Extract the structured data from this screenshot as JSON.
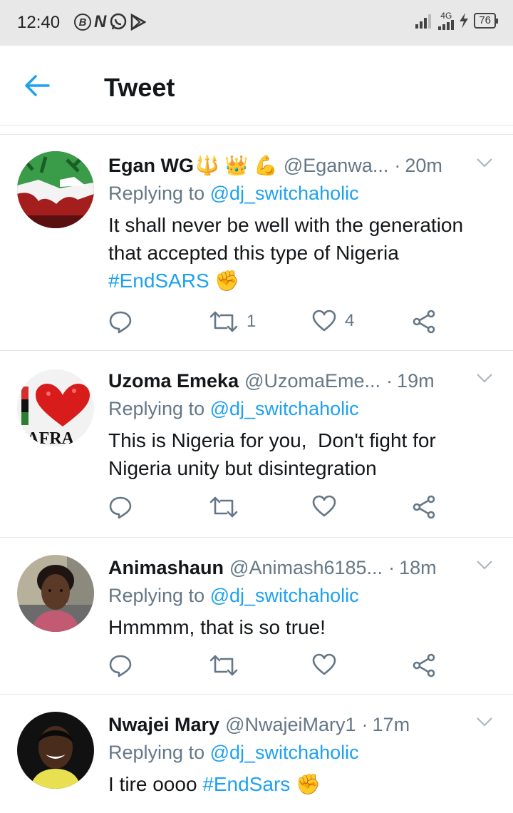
{
  "status_bar": {
    "time": "12:40",
    "left_icon_labels": [
      "B",
      "N"
    ],
    "network": "4G",
    "battery": "76"
  },
  "header": {
    "title": "Tweet"
  },
  "tweets": [
    {
      "name": "Egan WG",
      "name_emojis": "🔱 👑 💪",
      "handle": "@Eganwa...",
      "time": "20m",
      "reply_prefix": "Replying to",
      "reply_to": "@dj_switchaholic",
      "text": "It shall never be well with the generation that accepted this type of Nigeria",
      "hashtag": "#EndSARS",
      "hashtag_emoji": "✊",
      "retweets": "1",
      "likes": "4"
    },
    {
      "name": "Uzoma Emeka",
      "handle": "@UzomaEme...",
      "time": "19m",
      "reply_prefix": "Replying to",
      "reply_to": "@dj_switchaholic",
      "text": "This is Nigeria for you,  Don't fight for Nigeria unity but disintegration",
      "avatar_text": "IAFRA",
      "retweets": "",
      "likes": ""
    },
    {
      "name": "Animashaun",
      "handle": "@Animash6185...",
      "time": "18m",
      "reply_prefix": "Replying to",
      "reply_to": "@dj_switchaholic",
      "text": "Hmmmm, that is so true!",
      "retweets": "",
      "likes": ""
    },
    {
      "name": "Nwajei Mary",
      "handle": "@NwajeiMary1",
      "time": "17m",
      "reply_prefix": "Replying to",
      "reply_to": "@dj_switchaholic",
      "text": "I tire oooo",
      "hashtag": "#EndSars",
      "hashtag_emoji": "✊"
    }
  ],
  "colors": {
    "accent": "#1da1f2",
    "secondary_text": "#657786",
    "primary_text": "#14171a",
    "divider": "#e1e8ed",
    "status_bar_bg": "#e8e8e8"
  },
  "icons": {
    "back": "arrow-left-icon",
    "reply": "comment-icon",
    "retweet": "retweet-icon",
    "like": "heart-icon",
    "share": "share-icon",
    "more": "chevron-down-icon"
  }
}
